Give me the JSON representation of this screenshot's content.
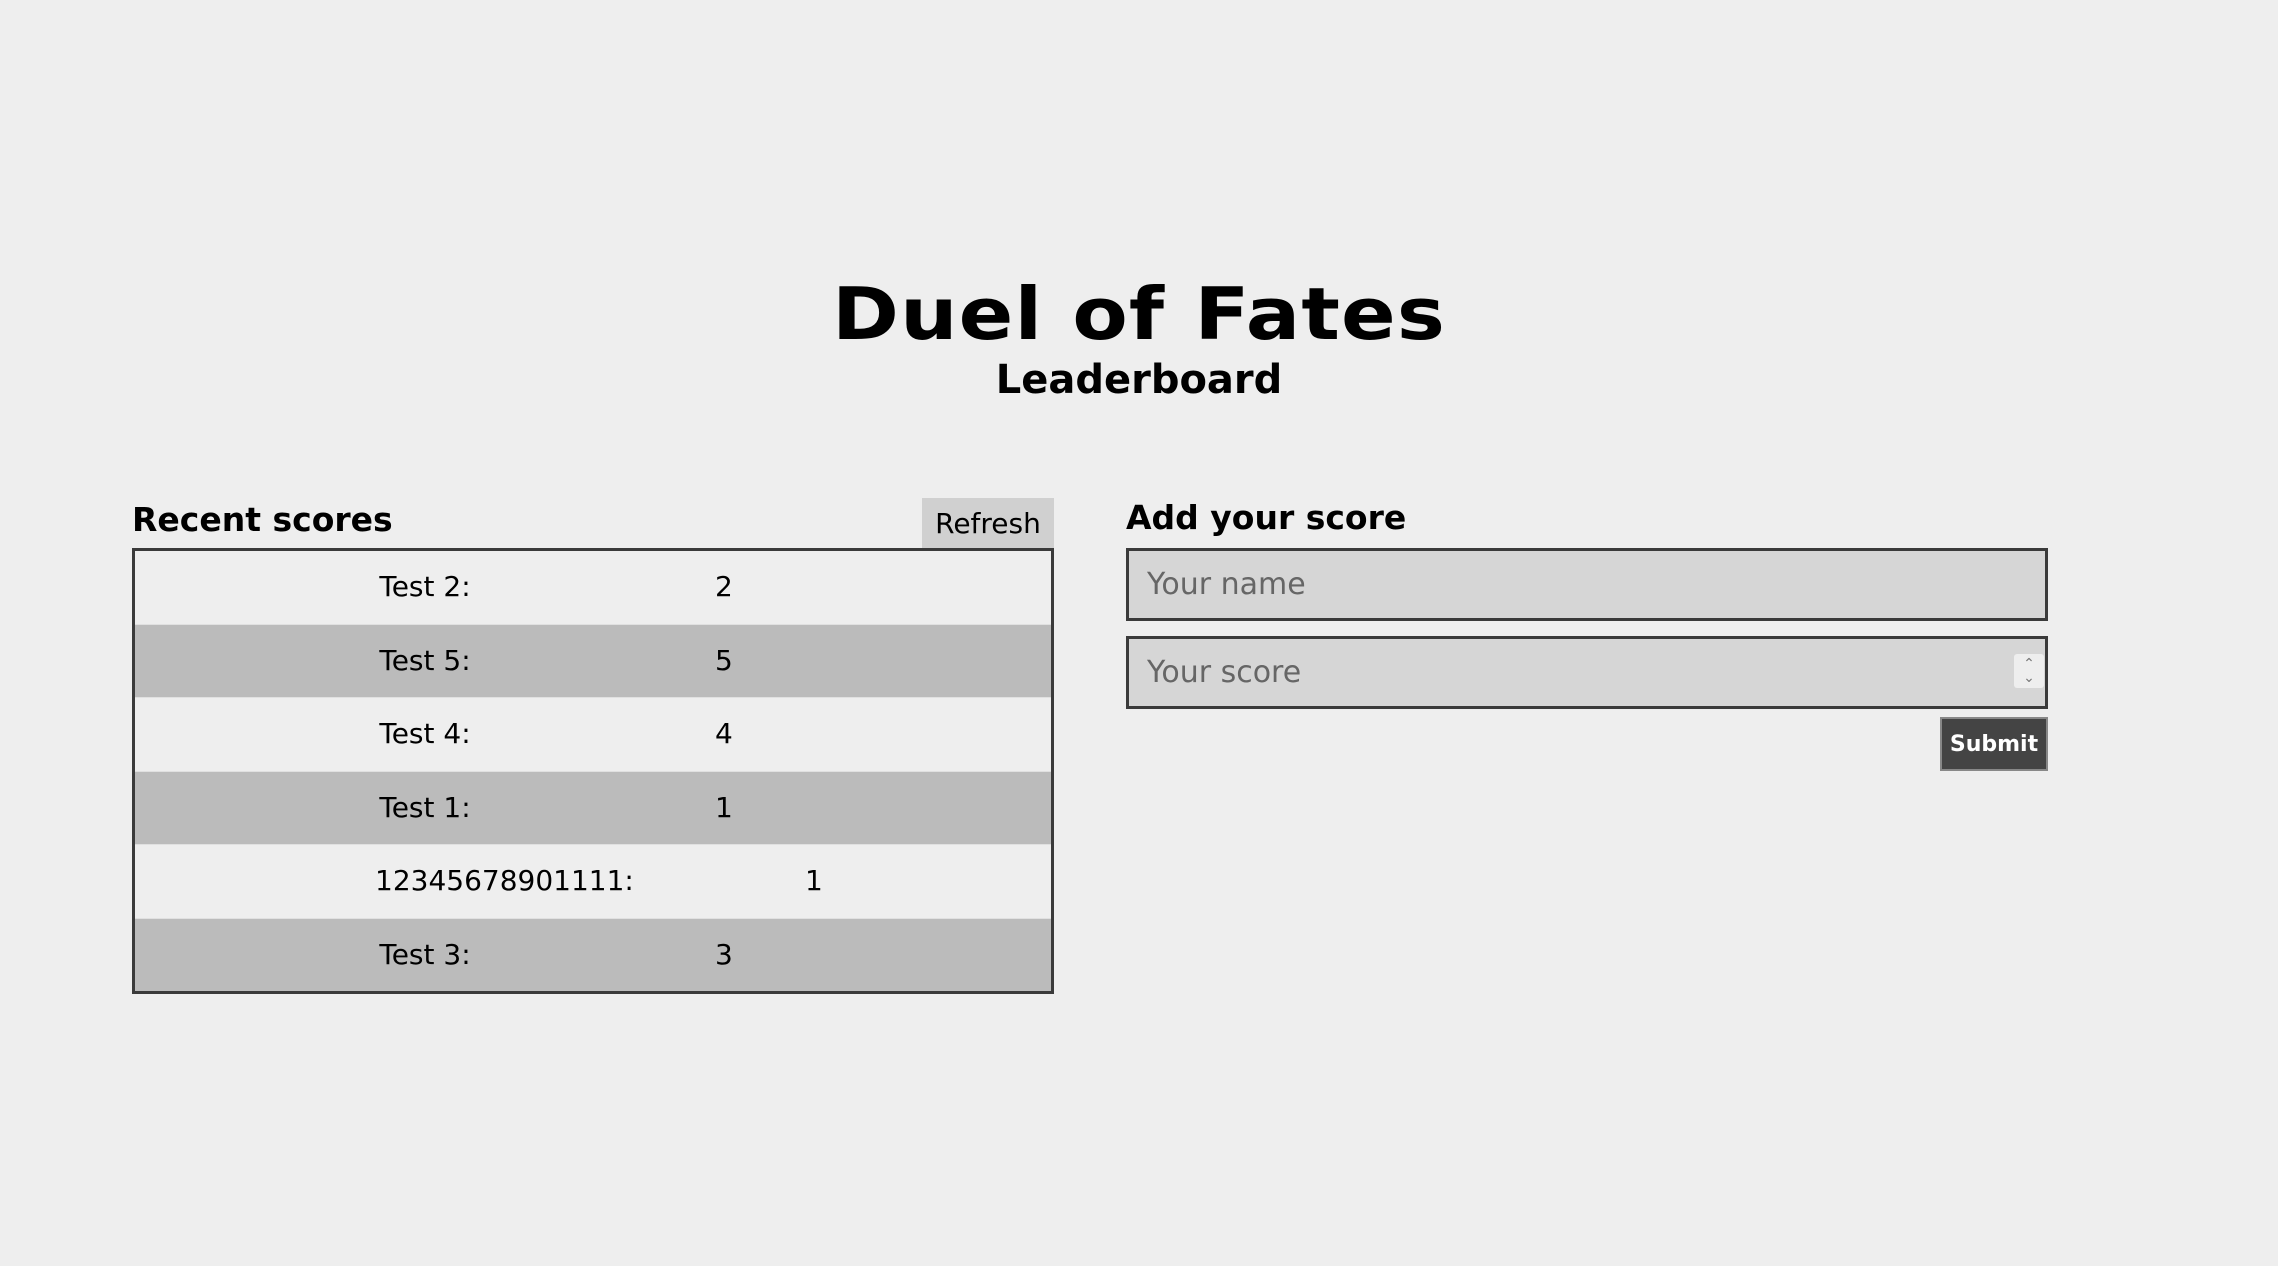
{
  "header": {
    "title": "Duel of Fates",
    "subtitle": "Leaderboard"
  },
  "recent": {
    "title": "Recent scores",
    "refresh_label": "Refresh",
    "rows": [
      {
        "name": "Test 2:",
        "score": "2"
      },
      {
        "name": "Test 5:",
        "score": "5"
      },
      {
        "name": "Test 4:",
        "score": "4"
      },
      {
        "name": "Test 1:",
        "score": "1"
      },
      {
        "name": "12345678901111:",
        "score": "1"
      },
      {
        "name": "Test 3:",
        "score": "3"
      }
    ]
  },
  "add": {
    "title": "Add your score",
    "name_placeholder": "Your name",
    "score_placeholder": "Your score",
    "submit_label": "Submit"
  },
  "colors": {
    "background": "#eeeeee",
    "row_alt": "#bbbbbb",
    "input_bg": "#d6d6d6",
    "submit_bg": "#444444",
    "refresh_bg": "#d0d0d0"
  }
}
